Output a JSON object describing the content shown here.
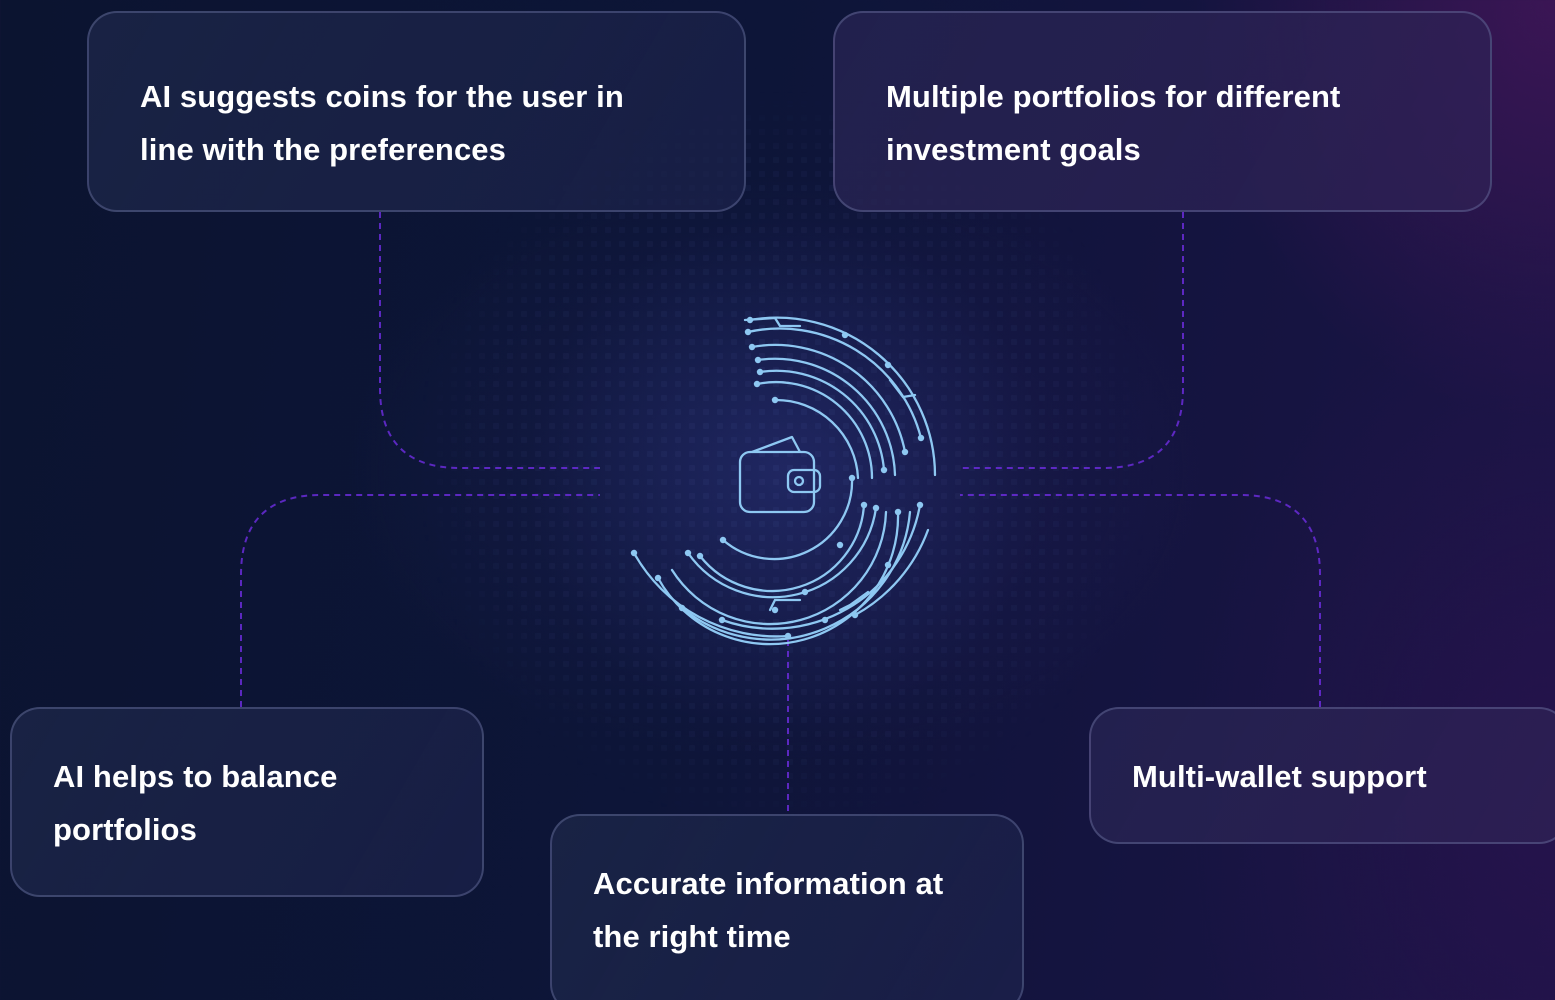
{
  "features": [
    {
      "id": "tl",
      "text": "AI suggests coins for the user in\nline with the preferences"
    },
    {
      "id": "tr",
      "text": "Multiple portfolios for different\ninvestment goals"
    },
    {
      "id": "bl",
      "text": "AI helps to balance\nportfolios"
    },
    {
      "id": "bc",
      "text": "Accurate information at\nthe right time"
    },
    {
      "id": "br",
      "text": "Multi-wallet support"
    }
  ],
  "center": {
    "icon": "wallet-icon",
    "decoration": "circuit-ring"
  },
  "colors": {
    "connector": "#6a2bd9",
    "circuit": "#8ec8f2",
    "card_text": "#ffffff",
    "card_border": "#4f5a85"
  }
}
